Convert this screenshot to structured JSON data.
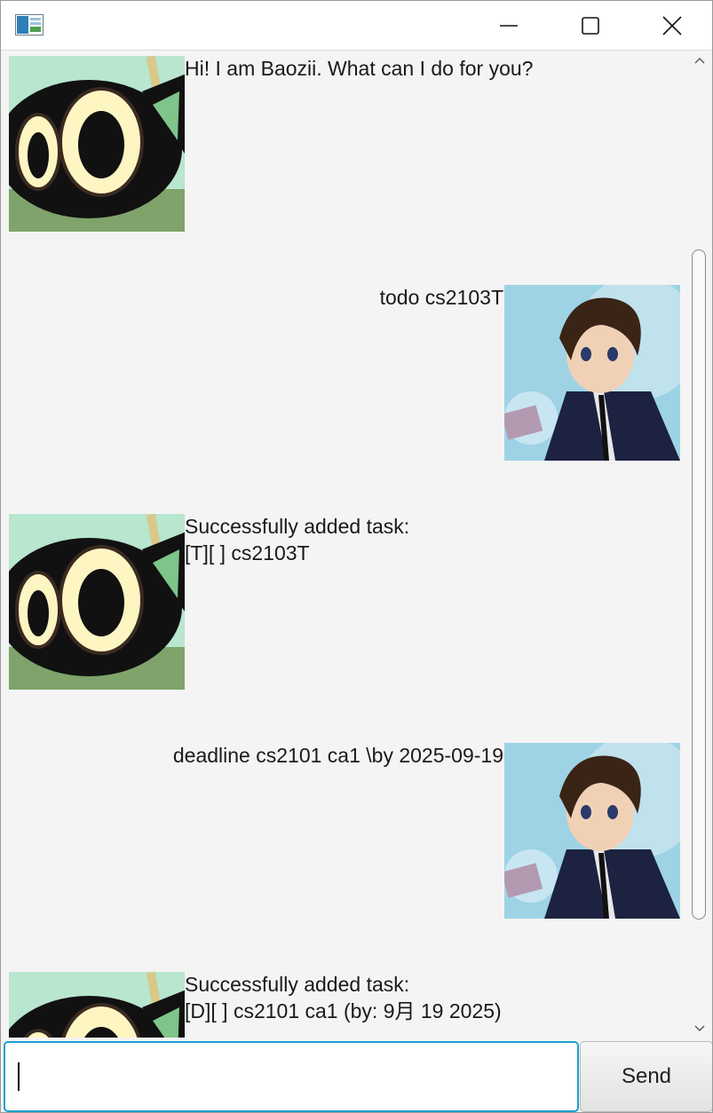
{
  "window": {
    "icon": "app-window-icon",
    "controls": {
      "minimize_icon": "minimize-icon",
      "maximize_icon": "maximize-icon",
      "close_icon": "close-icon"
    }
  },
  "chat": {
    "messages": [
      {
        "sender": "bot",
        "avatar": "black-cat-avatar",
        "lines": [
          "Hi! I am Baozii. What can I do for you?"
        ]
      },
      {
        "sender": "user",
        "avatar": "anime-boy-avatar",
        "lines": [
          "todo cs2103T"
        ]
      },
      {
        "sender": "bot",
        "avatar": "black-cat-avatar",
        "lines": [
          "Successfully added task:",
          "[T][ ] cs2103T"
        ]
      },
      {
        "sender": "user",
        "avatar": "anime-boy-avatar",
        "lines": [
          "deadline cs2101 ca1 \\by 2025-09-19"
        ]
      },
      {
        "sender": "bot",
        "avatar": "black-cat-avatar",
        "lines": [
          "Successfully added task:",
          "[D][ ] cs2101 ca1 (by: 9月 19 2025)"
        ]
      }
    ]
  },
  "input": {
    "value": "",
    "placeholder": ""
  },
  "send_button": {
    "label": "Send"
  },
  "colors": {
    "background": "#f4f4f4",
    "input_focus_border": "#1ca0cf",
    "text": "#1a1a1a"
  }
}
